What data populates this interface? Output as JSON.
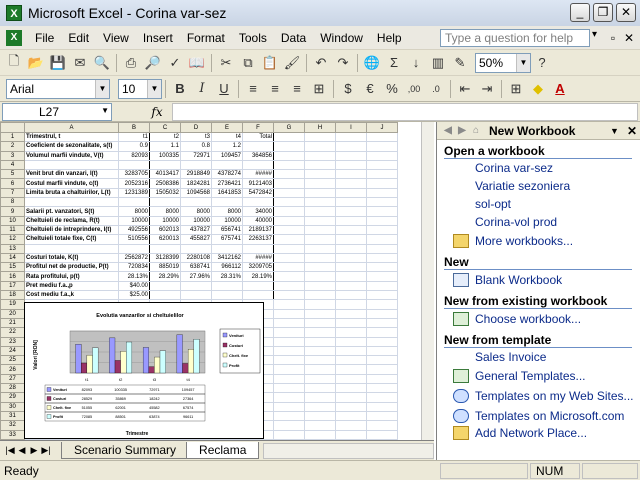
{
  "window": {
    "title": "Microsoft Excel - Corina var-sez"
  },
  "menu": {
    "items": [
      "File",
      "Edit",
      "View",
      "Insert",
      "Format",
      "Tools",
      "Data",
      "Window",
      "Help"
    ],
    "help_placeholder": "Type a question for help"
  },
  "toolbar": {
    "zoom": "50%",
    "font": "Arial",
    "font_size": "10"
  },
  "formula_bar": {
    "name_box": "L27",
    "fx": "fx",
    "value": ""
  },
  "sheet": {
    "columns": [
      "A",
      "B",
      "C",
      "D",
      "E",
      "F",
      "G",
      "H",
      "I",
      "J"
    ],
    "rows": [
      {
        "n": "1",
        "a": "Trimestrul, t",
        "b": "t1",
        "c": "t2",
        "d": "t3",
        "e": "t4",
        "f": "Total"
      },
      {
        "n": "2",
        "a": "Coeficient de sezonalitate, s(t)",
        "b": "0.9",
        "c": "1.1",
        "d": "0.8",
        "e": "1.2",
        "f": ""
      },
      {
        "n": "3",
        "a": "Volumul marfii vindute, V(t)",
        "b": "82093",
        "c": "100335",
        "d": "72971",
        "e": "109457",
        "f": "364856"
      },
      {
        "n": "4",
        "a": "",
        "b": "",
        "c": "",
        "d": "",
        "e": "",
        "f": ""
      },
      {
        "n": "5",
        "a": "Venit brut din vanzari, I(t)",
        "b": "3283705",
        "c": "4013417",
        "d": "2918849",
        "e": "4378274",
        "f": "#####"
      },
      {
        "n": "6",
        "a": "Costul marfii vindute, c(t)",
        "b": "2052316",
        "c": "2508386",
        "d": "1824281",
        "e": "2736421",
        "f": "9121403"
      },
      {
        "n": "7",
        "a": "Limita bruta a chaltuirilor, L(t)",
        "b": "1231389",
        "c": "1505032",
        "d": "1094568",
        "e": "1641853",
        "f": "5472842"
      },
      {
        "n": "8",
        "a": "",
        "b": "",
        "c": "",
        "d": "",
        "e": "",
        "f": ""
      },
      {
        "n": "9",
        "a": "Salarii pt. vanzatori, S(t)",
        "b": "8000",
        "c": "8000",
        "d": "8000",
        "e": "8000",
        "f": "34000"
      },
      {
        "n": "10",
        "a": "Cheltuieli de reclama, R(t)",
        "b": "10000",
        "c": "10000",
        "d": "10000",
        "e": "10000",
        "f": "40000"
      },
      {
        "n": "11",
        "a": "Cheltuieli de intreprindere, I(t)",
        "b": "492556",
        "c": "602013",
        "d": "437827",
        "e": "656741",
        "f": "2189137"
      },
      {
        "n": "12",
        "a": "Cheltuieli totale fixe, C(t)",
        "b": "510556",
        "c": "620013",
        "d": "455827",
        "e": "675741",
        "f": "2263137"
      },
      {
        "n": "13",
        "a": "",
        "b": "",
        "c": "",
        "d": "",
        "e": "",
        "f": ""
      },
      {
        "n": "14",
        "a": "Costuri totale, K(t)",
        "b": "2562872",
        "c": "3128399",
        "d": "2280108",
        "e": "3412162",
        "f": "#####"
      },
      {
        "n": "15",
        "a": "Profitul net de productie, P(t)",
        "b": "720834",
        "c": "885019",
        "d": "638741",
        "e": "966112",
        "f": "3209705"
      },
      {
        "n": "16",
        "a": "Rata profitului, p(t)",
        "b": "28.13%",
        "c": "28.29%",
        "d": "27.96%",
        "e": "28.31%",
        "f": "28.19%"
      },
      {
        "n": "17",
        "a": "Pret mediu f.a.,p",
        "b": "$40.00",
        "c": "",
        "d": "",
        "e": "",
        "f": ""
      },
      {
        "n": "18",
        "a": "Cost mediu f.a.,k",
        "b": "$25.00",
        "c": "",
        "d": "",
        "e": "",
        "f": ""
      },
      {
        "n": "19",
        "a": "",
        "b": "",
        "c": "",
        "d": "",
        "e": "",
        "f": ""
      },
      {
        "n": "20",
        "a": "",
        "b": "",
        "c": "",
        "d": "",
        "e": "",
        "f": ""
      },
      {
        "n": "21",
        "a": "",
        "b": "",
        "c": "",
        "d": "",
        "e": "",
        "f": ""
      },
      {
        "n": "22",
        "a": "",
        "b": "",
        "c": "",
        "d": "",
        "e": "",
        "f": ""
      },
      {
        "n": "23",
        "a": "",
        "b": "",
        "c": "",
        "d": "",
        "e": "",
        "f": ""
      },
      {
        "n": "24",
        "a": "",
        "b": "",
        "c": "",
        "d": "",
        "e": "",
        "f": ""
      },
      {
        "n": "25",
        "a": "",
        "b": "",
        "c": "",
        "d": "",
        "e": "",
        "f": ""
      },
      {
        "n": "26",
        "a": "",
        "b": "",
        "c": "",
        "d": "",
        "e": "",
        "f": ""
      },
      {
        "n": "27",
        "a": "",
        "b": "",
        "c": "",
        "d": "",
        "e": "",
        "f": ""
      },
      {
        "n": "28",
        "a": "",
        "b": "",
        "c": "",
        "d": "",
        "e": "",
        "f": ""
      },
      {
        "n": "29",
        "a": "",
        "b": "",
        "c": "",
        "d": "",
        "e": "",
        "f": ""
      },
      {
        "n": "30",
        "a": "",
        "b": "",
        "c": "",
        "d": "",
        "e": "",
        "f": ""
      },
      {
        "n": "31",
        "a": "",
        "b": "",
        "c": "",
        "d": "",
        "e": "",
        "f": ""
      },
      {
        "n": "32",
        "a": "",
        "b": "",
        "c": "",
        "d": "",
        "e": "",
        "f": ""
      },
      {
        "n": "33",
        "a": "",
        "b": "",
        "c": "",
        "d": "",
        "e": "",
        "f": ""
      },
      {
        "n": "34",
        "a": "",
        "b": "",
        "c": "",
        "d": "",
        "e": "",
        "f": ""
      }
    ]
  },
  "chart_data": {
    "type": "bar",
    "title": "Evolutia vanzarilor si cheltuielilor",
    "ylabel": "Valori [RON]",
    "xlabel": "Trimestre",
    "categories": [
      "t1",
      "t2",
      "t3",
      "t4"
    ],
    "series": [
      {
        "name": "Venituri",
        "values": [
          82093,
          100335,
          72971,
          109457
        ],
        "color": "#9999ff"
      },
      {
        "name": "Costuri",
        "values": [
          28529,
          35869,
          18242,
          27364
        ],
        "color": "#993366"
      },
      {
        "name": "Chelt. fixe",
        "values": [
          51055,
          62001,
          45582,
          67574
        ],
        "color": "#ffffcc"
      },
      {
        "name": "Profit",
        "values": [
          72085,
          88501,
          63874,
          96611
        ],
        "color": "#ccffff"
      }
    ],
    "ylim": [
      0,
      120000
    ],
    "table_rows": [
      [
        "82093",
        "100335",
        "72971",
        "109457"
      ],
      [
        "28529",
        "35869",
        "18242",
        "27364"
      ],
      [
        "51055",
        "62001",
        "45582",
        "67574"
      ],
      [
        "72085",
        "88501",
        "63874",
        "96611"
      ]
    ]
  },
  "tabs": [
    "Scenario Summary",
    "Reclama"
  ],
  "status": {
    "left": "Ready",
    "num": "NUM"
  },
  "taskpane": {
    "title": "New Workbook",
    "open_heading": "Open a workbook",
    "open_files": [
      "Corina var-sez",
      "Variatie sezoniera",
      "sol-opt",
      "Corina-vol prod"
    ],
    "more": "More workbooks...",
    "new_heading": "New",
    "blank": "Blank Workbook",
    "existing_heading": "New from existing workbook",
    "choose": "Choose workbook...",
    "template_heading": "New from template",
    "templates": [
      "Sales Invoice",
      "General Templates...",
      "Templates on my Web Sites...",
      "Templates on Microsoft.com"
    ],
    "add_network": "Add Network Place..."
  }
}
